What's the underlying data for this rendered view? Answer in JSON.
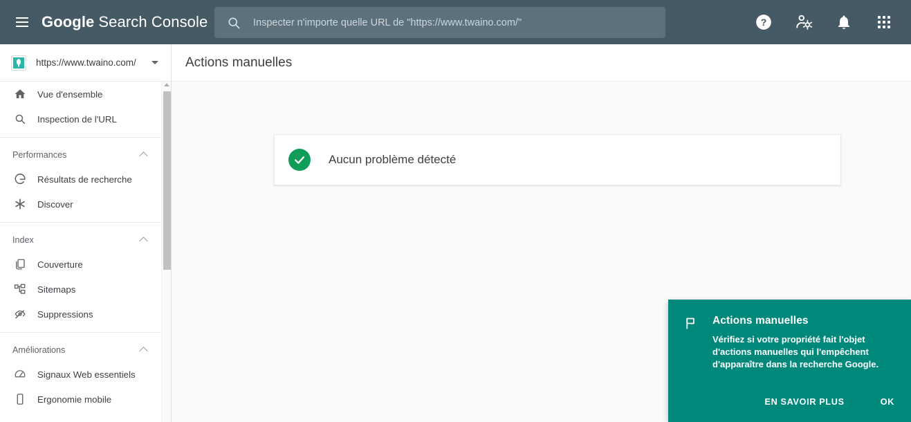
{
  "topbar": {
    "menu_icon": "hamburger-menu-icon",
    "brand_google": "Google",
    "brand_rest": "Search Console",
    "search": {
      "icon": "search-icon",
      "value": "",
      "placeholder": "Inspecter n'importe quelle URL de \"https://www.twaino.com/\""
    },
    "icons": [
      {
        "name": "help-icon",
        "label": "Aide"
      },
      {
        "name": "account-settings-icon",
        "label": "Paramètres du compte"
      },
      {
        "name": "notifications-bell-icon",
        "label": "Notifications"
      },
      {
        "name": "apps-grid-icon",
        "label": "Applications Google"
      }
    ],
    "background_color": "#455a64"
  },
  "sidebar": {
    "property": {
      "url": "https://www.twaino.com/",
      "favicon_name": "twaino-favicon",
      "favicon_color": "#2ab7a9",
      "dropdown_icon": "chevron-down-icon"
    },
    "top_items": [
      {
        "label": "Vue d'ensemble",
        "icon": "home-icon"
      },
      {
        "label": "Inspection de l'URL",
        "icon": "search-icon"
      }
    ],
    "groups": [
      {
        "title": "Performances",
        "collapse_icon": "chevron-up-icon",
        "items": [
          {
            "label": "Résultats de recherche",
            "icon": "google-g-icon"
          },
          {
            "label": "Discover",
            "icon": "discover-asterisk-icon"
          }
        ]
      },
      {
        "title": "Index",
        "collapse_icon": "chevron-up-icon",
        "items": [
          {
            "label": "Couverture",
            "icon": "pages-copy-icon"
          },
          {
            "label": "Sitemaps",
            "icon": "sitemap-tree-icon"
          },
          {
            "label": "Suppressions",
            "icon": "eye-off-icon"
          }
        ]
      },
      {
        "title": "Améliorations",
        "collapse_icon": "chevron-up-icon",
        "items": [
          {
            "label": "Signaux Web essentiels",
            "icon": "speedometer-icon"
          },
          {
            "label": "Ergonomie mobile",
            "icon": "mobile-phone-icon"
          }
        ]
      }
    ],
    "scrollbar": {
      "up_arrow_icon": "scroll-up-arrow-icon",
      "thumb_name": "scrollbar-thumb"
    }
  },
  "main": {
    "page_title": "Actions manuelles",
    "status_card": {
      "icon": "check-circle-icon",
      "icon_color": "#0f9d58",
      "text": "Aucun problème détecté"
    }
  },
  "promo_popup": {
    "icon": "flag-icon",
    "title": "Actions manuelles",
    "text": "Vérifiez si votre propriété fait l'objet d'actions manuelles qui l'empêchent d'apparaître dans la recherche Google.",
    "learn_more_label": "EN SAVOIR PLUS",
    "ok_label": "OK",
    "background_color": "#00897b"
  }
}
